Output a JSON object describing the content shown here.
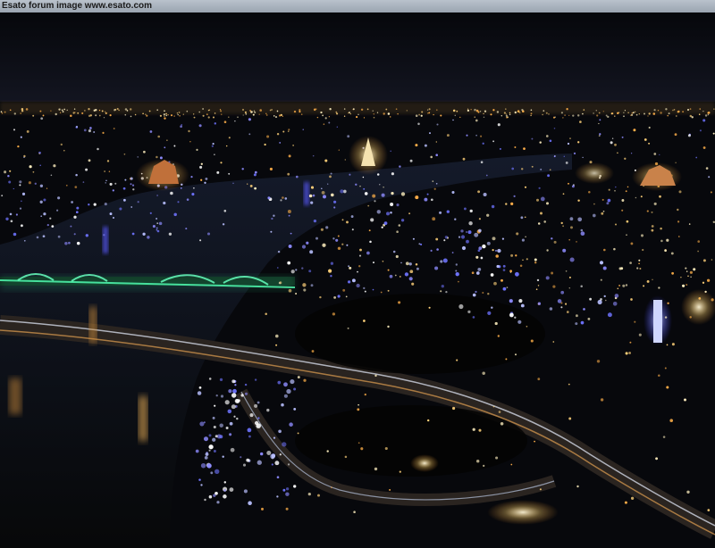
{
  "caption": {
    "text": "Esato forum image www.esato.com"
  },
  "photo": {
    "alt": "Night aerial view of a city with a river, lit bridges, temples and highway light trails"
  }
}
